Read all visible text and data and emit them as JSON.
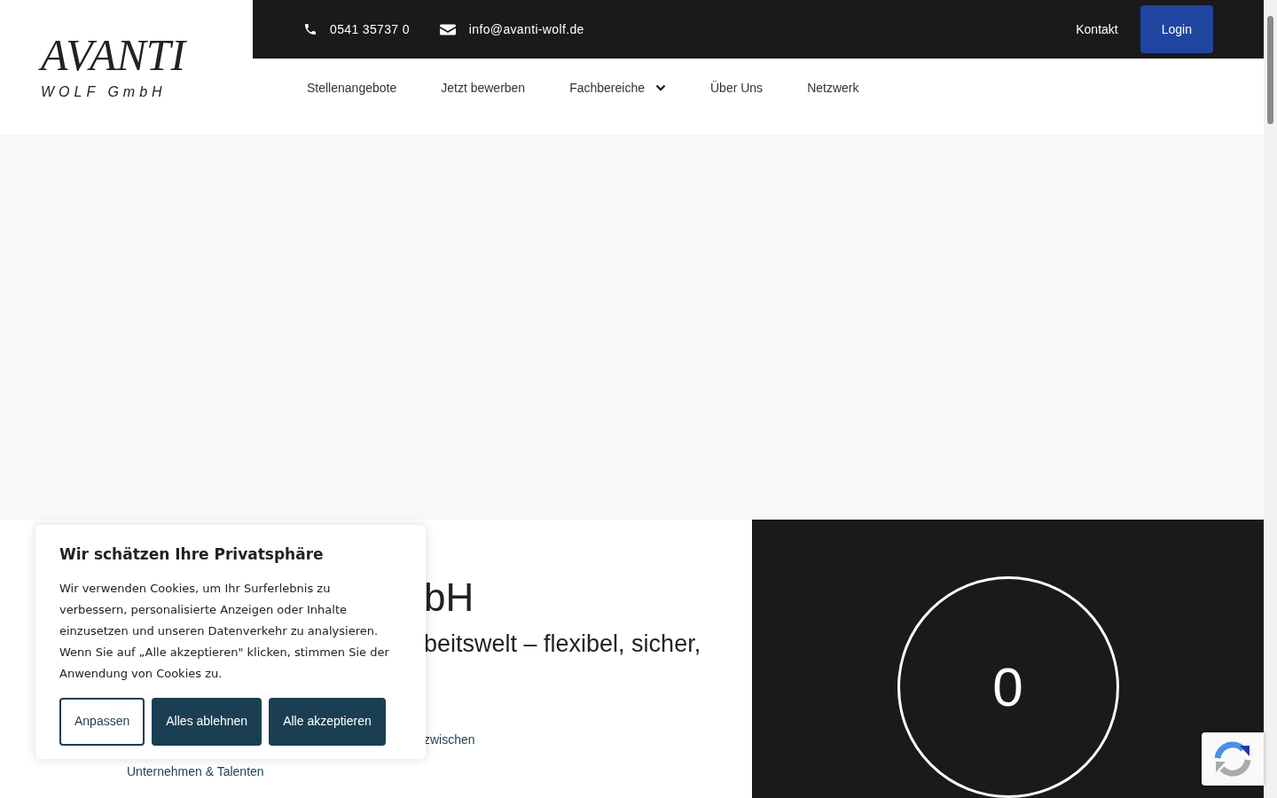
{
  "logo": {
    "wordmark": "AVANTI",
    "subline": "WOLF GmbH"
  },
  "topbar": {
    "phone": "0541 35737 0",
    "email": "info@avanti-wolf.de",
    "links": [
      {
        "label": "Kontakt",
        "kind": "link"
      },
      {
        "label": "Login",
        "kind": "button"
      }
    ]
  },
  "nav": [
    {
      "label": "Stellenangebote",
      "dropdown": false
    },
    {
      "label": "Jetzt bewerben",
      "dropdown": false
    },
    {
      "label": "Fachbereiche",
      "dropdown": true
    },
    {
      "label": "Über Uns",
      "dropdown": false
    },
    {
      "label": "Netzwerk",
      "dropdown": false
    }
  ],
  "intro": {
    "heading_fragment": "bH",
    "subheading_fragment": "beitswelt – flexibel, sicher,",
    "text_fragment": "zwischen",
    "text_line": "Unternehmen & Talenten"
  },
  "counter": {
    "value": "0"
  },
  "cookie_banner": {
    "title": "Wir schätzen Ihre Privatsphäre",
    "text": "Wir verwenden Cookies, um Ihr Surferlebnis zu verbessern, personalisierte Anzeigen oder Inhalte einzusetzen und unseren Datenverkehr zu analysieren. Wenn Sie auf „Alle akzeptieren\" klicken, stimmen Sie der Anwendung von Cookies zu.",
    "buttons": [
      {
        "label": "Anpassen",
        "kind": "outline"
      },
      {
        "label": "Alles ablehnen",
        "kind": "filled"
      },
      {
        "label": "Alle akzeptieren",
        "kind": "filled"
      }
    ]
  }
}
